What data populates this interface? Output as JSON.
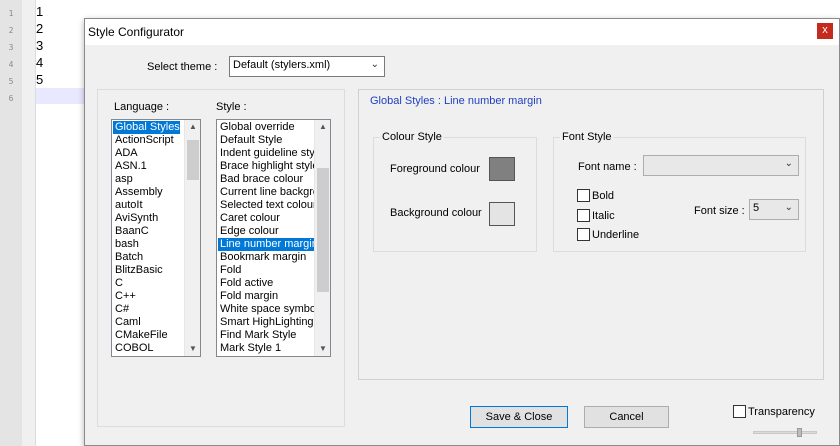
{
  "editor": {
    "line_numbers": [
      "1",
      "2",
      "3",
      "4",
      "5",
      "6"
    ],
    "lines": [
      "1",
      "2",
      "3",
      "4",
      "5",
      ""
    ]
  },
  "dialog": {
    "title": "Style Configurator",
    "close_glyph": "x",
    "select_theme_label": "Select theme :",
    "theme_value": "Default (stylers.xml)",
    "language_label": "Language :",
    "style_label": "Style :",
    "languages": [
      "Global Styles",
      "ActionScript",
      "ADA",
      "ASN.1",
      "asp",
      "Assembly",
      "autoIt",
      "AviSynth",
      "BaanC",
      "bash",
      "Batch",
      "BlitzBasic",
      "C",
      "C++",
      "C#",
      "Caml",
      "CMakeFile",
      "COBOL"
    ],
    "styles": [
      "Global override",
      "Default Style",
      "Indent guideline style",
      "Brace highlight style",
      "Bad brace colour",
      "Current line background colour",
      "Selected text colour",
      "Caret colour",
      "Edge colour",
      "Line number margin",
      "Bookmark margin",
      "Fold",
      "Fold active",
      "Fold margin",
      "White space symbol",
      "Smart HighLighting",
      "Find Mark Style",
      "Mark Style 1"
    ],
    "selected_language": "Global Styles",
    "selected_style": "Line number margin",
    "panel_title": "Global Styles : Line number margin",
    "colour_style_group": "Colour Style",
    "foreground_label": "Foreground colour",
    "background_label": "Background colour",
    "foreground_color": "#808080",
    "background_color": "#e4e4e4",
    "font_style_group": "Font Style",
    "font_name_label": "Font name :",
    "font_name_value": "",
    "bold_label": "Bold",
    "italic_label": "Italic",
    "underline_label": "Underline",
    "font_size_label": "Font size :",
    "font_size_value": "5",
    "save_close_label": "Save & Close",
    "cancel_label": "Cancel",
    "transparency_label": "Transparency"
  }
}
